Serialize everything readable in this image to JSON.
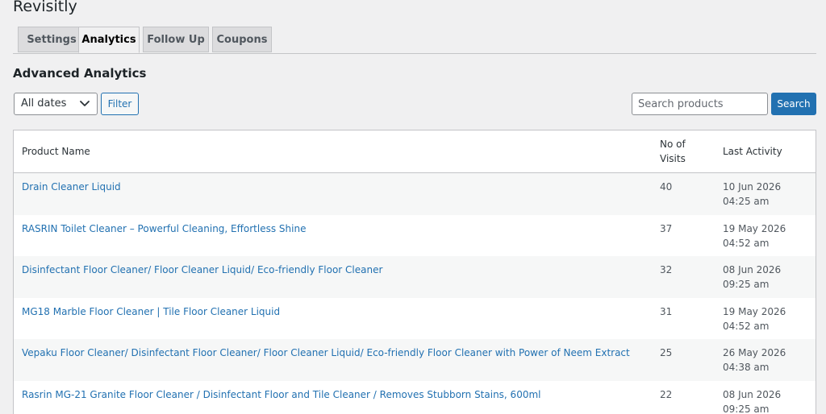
{
  "app": {
    "title": "Revisitly"
  },
  "tabs": [
    {
      "label": "Settings",
      "active": false
    },
    {
      "label": "Analytics",
      "active": true
    },
    {
      "label": "Follow Up",
      "active": false
    },
    {
      "label": "Coupons",
      "active": false
    }
  ],
  "section": {
    "title": "Advanced Analytics"
  },
  "filters": {
    "date_selected": "All dates",
    "filter_label": "Filter",
    "search_placeholder": "Search products",
    "search_label": "Search"
  },
  "table": {
    "columns": [
      "Product Name",
      "No of Visits",
      "Last Activity"
    ],
    "rows": [
      {
        "name": "Drain Cleaner Liquid",
        "visits": "40",
        "activity": "10 Jun 2026 04:25 am"
      },
      {
        "name": "RASRIN Toilet Cleaner – Powerful Cleaning, Effortless Shine",
        "visits": "37",
        "activity": "19 May 2026 04:52 am"
      },
      {
        "name": "Disinfectant Floor Cleaner/ Floor Cleaner Liquid/ Eco-friendly Floor Cleaner",
        "visits": "32",
        "activity": "08 Jun 2026 09:25 am"
      },
      {
        "name": "MG18 Marble Floor Cleaner | Tile Floor Cleaner Liquid",
        "visits": "31",
        "activity": "19 May 2026 04:52 am"
      },
      {
        "name": "Vepaku Floor Cleaner/ Disinfectant Floor Cleaner/ Floor Cleaner Liquid/ Eco-friendly Floor Cleaner with Power of Neem Extract",
        "visits": "25",
        "activity": "26 May 2026 04:38 am"
      },
      {
        "name": "Rasrin MG-21 Granite Floor Cleaner / Disinfectant Floor and Tile Cleaner / Removes Stubborn Stains, 600ml",
        "visits": "22",
        "activity": "08 Jun 2026 09:25 am"
      }
    ]
  },
  "colors": {
    "link": "#2271b1",
    "primary_button": "#2271b1",
    "background": "#f0f0f1",
    "striped_row": "#f6f7f7"
  },
  "icons": {
    "date_dropdown": "chevron-down-icon"
  }
}
